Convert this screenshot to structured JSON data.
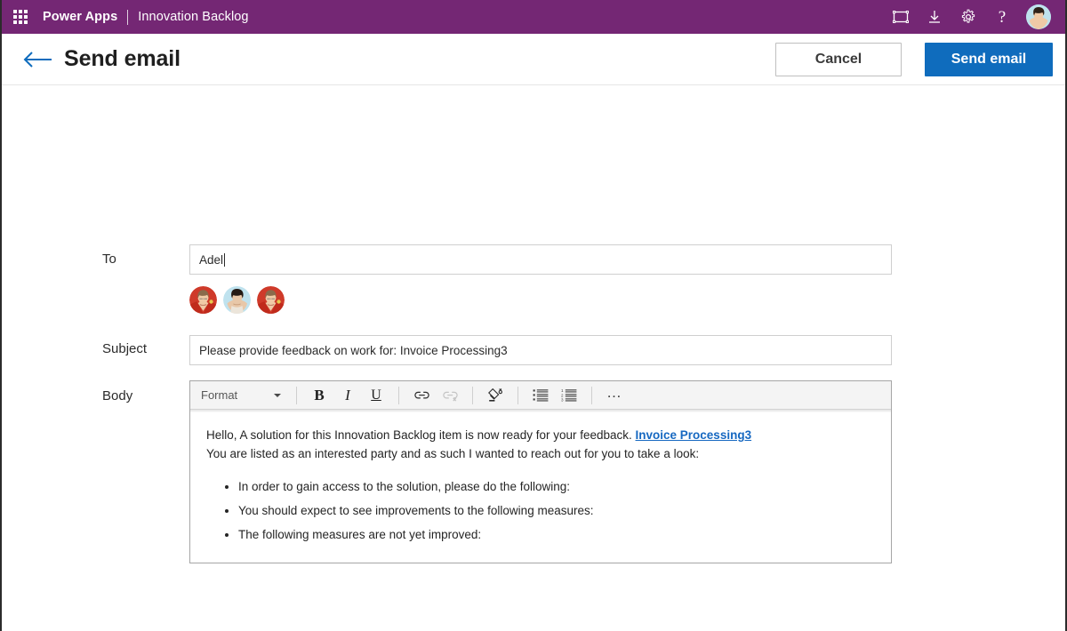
{
  "suite": {
    "waffle_label": "app-launcher",
    "product": "Power Apps",
    "separator": "|",
    "app_name": "Innovation Backlog",
    "icons": [
      {
        "name": "fit-to-screen-icon",
        "label": "Fit to screen"
      },
      {
        "name": "download-icon",
        "label": "Download"
      },
      {
        "name": "gear-icon",
        "label": "Settings"
      },
      {
        "name": "help-icon",
        "label": "?"
      }
    ],
    "avatar_label": "user-avatar"
  },
  "command_bar": {
    "back_label": "Back",
    "title": "Send email",
    "cancel_label": "Cancel",
    "send_label": "Send email"
  },
  "form": {
    "to": {
      "label": "To",
      "value": "Adel",
      "placeholder": "",
      "recipients": [
        {
          "name": "recipient-avatar-1"
        },
        {
          "name": "recipient-avatar-2"
        },
        {
          "name": "recipient-avatar-3"
        }
      ]
    },
    "subject": {
      "label": "Subject",
      "value": "Please provide feedback on work for: Invoice Processing3",
      "placeholder": ""
    },
    "body": {
      "label": "Body",
      "toolbar": {
        "format_label": "Format",
        "bold_label": "B",
        "italic_label": "I",
        "underline_label": "U",
        "link_label": "Link",
        "unlink_label": "Unlink",
        "clear_format_label": "Clear formatting",
        "bulleted_list_label": "Bulleted list",
        "numbered_list_label": "Numbered list",
        "overflow_label": "…"
      },
      "content": {
        "line1_before_link": "Hello, A solution for this Innovation Backlog item is now ready for your feedback. ",
        "line1_link": "Invoice Processing3",
        "line2": "You are listed as an interested party and as such I wanted to reach out for you to take a look:",
        "bullets": [
          "In order to gain access to the solution, please do the following:",
          "You should expect to see improvements to the following measures:",
          "The following measures are not yet improved:"
        ]
      }
    }
  },
  "colors": {
    "brand_purple": "#742774",
    "primary_blue": "#0f6cbd",
    "link_blue": "#1668c1",
    "back_arrow_blue": "#0f6cbd"
  }
}
